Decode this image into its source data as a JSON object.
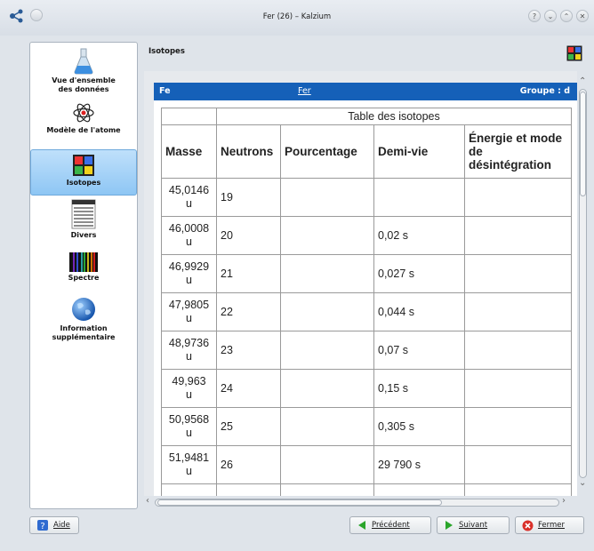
{
  "window": {
    "title": "Fer (26) – Kalzium"
  },
  "sidebar": {
    "items": [
      {
        "label": "Vue d'ensemble\ndes données",
        "icon": "flask-icon"
      },
      {
        "label": "Modèle de l'atome",
        "icon": "atom-icon"
      },
      {
        "label": "Isotopes",
        "icon": "isotopes-icon",
        "active": true
      },
      {
        "label": "Divers",
        "icon": "misc-icon"
      },
      {
        "label": "Spectre",
        "icon": "spectrum-icon"
      },
      {
        "label": "Information\nsupplémentaire",
        "icon": "globe-icon"
      }
    ]
  },
  "page": {
    "title": "Isotopes"
  },
  "element_bar": {
    "symbol": "Fe",
    "name": "Fer",
    "group": "Groupe : d"
  },
  "table": {
    "caption": "Table des isotopes",
    "headers": [
      "Masse",
      "Neutrons",
      "Pourcentage",
      "Demi-vie",
      "Énergie et mode de désintégration"
    ],
    "rows": [
      {
        "mass": "45,0146",
        "unit": "u",
        "neutrons": "19",
        "percent": "",
        "halflife": ""
      },
      {
        "mass": "46,0008",
        "unit": "u",
        "neutrons": "20",
        "percent": "",
        "halflife": "0,02 s"
      },
      {
        "mass": "46,9929",
        "unit": "u",
        "neutrons": "21",
        "percent": "",
        "halflife": "0,027 s"
      },
      {
        "mass": "47,9805",
        "unit": "u",
        "neutrons": "22",
        "percent": "",
        "halflife": "0,044 s"
      },
      {
        "mass": "48,9736",
        "unit": "u",
        "neutrons": "23",
        "percent": "",
        "halflife": "0,07 s"
      },
      {
        "mass": "49,963",
        "unit": "u",
        "neutrons": "24",
        "percent": "",
        "halflife": "0,15 s"
      },
      {
        "mass": "50,9568",
        "unit": "u",
        "neutrons": "25",
        "percent": "",
        "halflife": "0,305 s"
      },
      {
        "mass": "51,9481",
        "unit": "u",
        "neutrons": "26",
        "percent": "",
        "halflife": "29 790 s"
      }
    ]
  },
  "buttons": {
    "help": "Aide",
    "previous": "Précédent",
    "next": "Suivant",
    "close": "Fermer"
  },
  "colors": {
    "accent": "#1560b8",
    "selection": "#9ccbf5"
  }
}
